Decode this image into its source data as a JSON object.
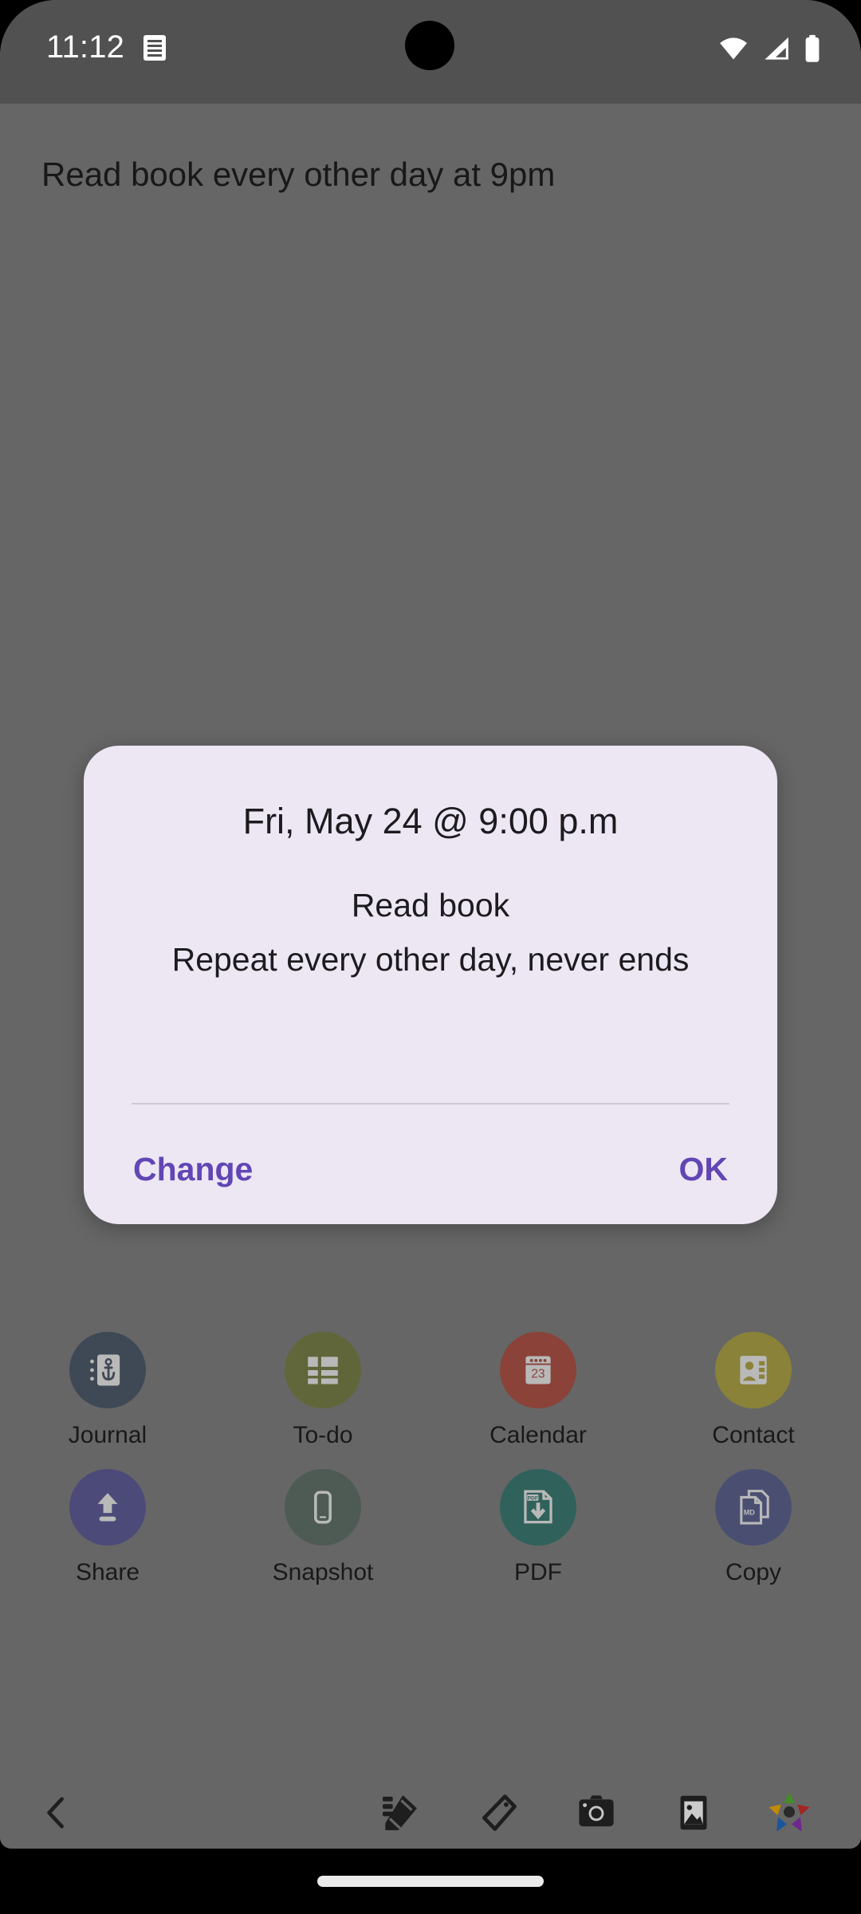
{
  "status_bar": {
    "clock": "11:12",
    "notification_icon": "notification-list-icon",
    "wifi_icon": "wifi-icon",
    "signal_icon": "cellular-signal-icon",
    "battery_icon": "battery-full-icon",
    "camera_cutout": "front-camera-punch-hole"
  },
  "background": {
    "title": "Read book every other day at 9pm",
    "scrim_color": "#727272"
  },
  "dialog": {
    "title": "Fri, May 24 @ 9:00 p.m",
    "message": "Read book\nRepeat every other day, never ends",
    "surface_color": "#EDE7F3",
    "accent_color": "#6246B4",
    "divider_color": "#cfc7d6",
    "actions": {
      "change_label": "Change",
      "ok_label": "OK"
    }
  },
  "icon_grid": {
    "rows": [
      {
        "items": [
          {
            "label": "Journal",
            "icon": "journal-anchor-icon",
            "color": "#3c4a5a"
          },
          {
            "label": "To-do",
            "icon": "todo-grid-icon",
            "color": "#6c7334"
          },
          {
            "label": "Calendar",
            "icon": "calendar-23-icon",
            "color": "#a63f32",
            "day": "23"
          },
          {
            "label": "Contact",
            "icon": "contact-card-icon",
            "color": "#a69a33"
          }
        ]
      },
      {
        "items": [
          {
            "label": "Share",
            "icon": "share-upload-icon",
            "color": "#4e4b8e"
          },
          {
            "label": "Snapshot",
            "icon": "snapshot-phone-icon",
            "color": "#4f6359"
          },
          {
            "label": "PDF",
            "icon": "pdf-download-icon",
            "color": "#266b63",
            "badge": "PDF"
          },
          {
            "label": "Copy",
            "icon": "copy-markdown-icon",
            "color": "#4b5283",
            "badge": "MD"
          }
        ]
      }
    ]
  },
  "bottom_toolbar": {
    "items": [
      {
        "name": "back-chevron-icon"
      },
      {
        "name": "note-edit-icon"
      },
      {
        "name": "tag-icon"
      },
      {
        "name": "camera-icon"
      },
      {
        "name": "gallery-image-icon"
      },
      {
        "name": "colorful-star-icon"
      }
    ]
  },
  "gesture_nav": {
    "pill": "home-gesture-pill"
  }
}
